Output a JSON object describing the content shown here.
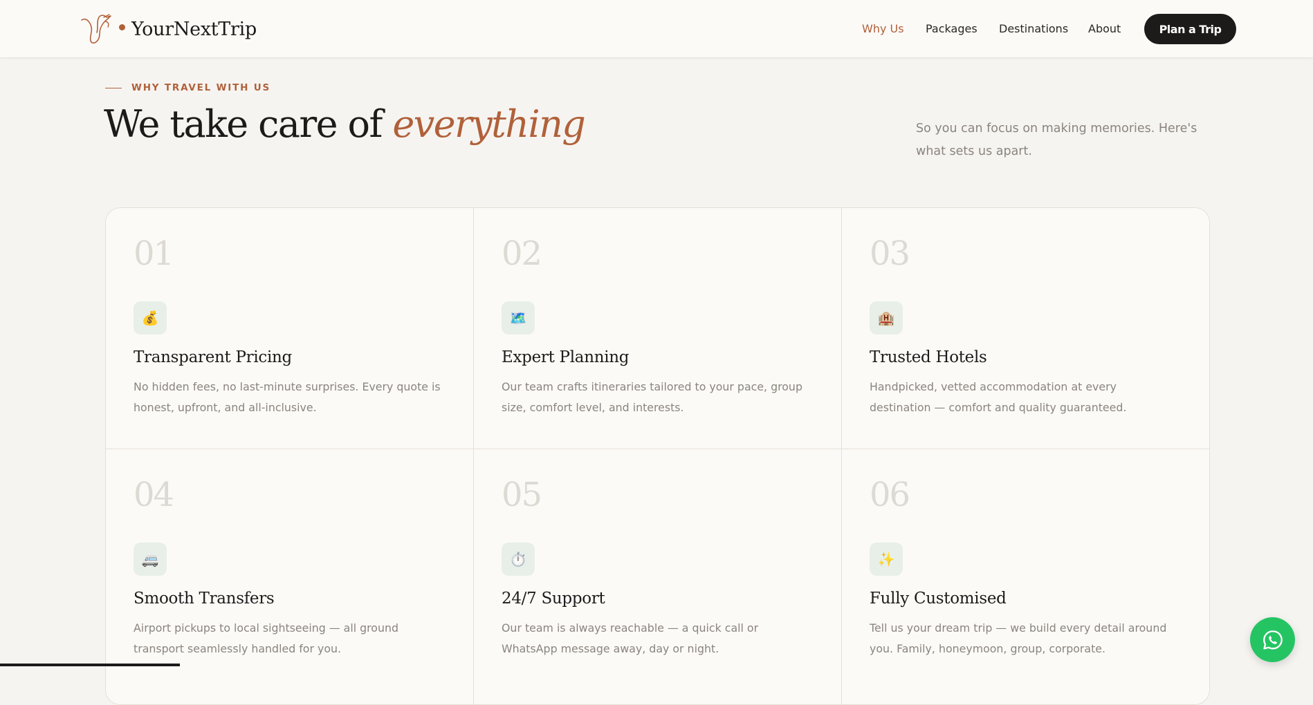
{
  "header": {
    "brand": "YourNextTrip",
    "nav": [
      {
        "label": "Why Us",
        "active": true
      },
      {
        "label": "Packages",
        "active": false
      },
      {
        "label": "Destinations",
        "active": false
      },
      {
        "label": "About",
        "active": false
      }
    ],
    "cta_label": "Plan a Trip"
  },
  "section": {
    "eyebrow": "WHY TRAVEL WITH US",
    "title_plain": "We take care of ",
    "title_accent": "everything",
    "subtitle": "So you can focus on making memories. Here's what sets us apart."
  },
  "features": [
    {
      "num": "01",
      "icon": "money-bag-icon",
      "glyph": "💰",
      "title": "Transparent Pricing",
      "desc": "No hidden fees, no last-minute surprises. Every quote is honest, upfront, and all-inclusive."
    },
    {
      "num": "02",
      "icon": "map-icon",
      "glyph": "🗺️",
      "title": "Expert Planning",
      "desc": "Our team crafts itineraries tailored to your pace, group size, comfort level, and interests."
    },
    {
      "num": "03",
      "icon": "hotel-icon",
      "glyph": "🏨",
      "title": "Trusted Hotels",
      "desc": "Handpicked, vetted accommodation at every destination — comfort and quality guaranteed."
    },
    {
      "num": "04",
      "icon": "van-icon",
      "glyph": "🚐",
      "title": "Smooth Transfers",
      "desc": "Airport pickups to local sightseeing — all ground transport seamlessly handled for you."
    },
    {
      "num": "05",
      "icon": "stopwatch-icon",
      "glyph": "⏱️",
      "title": "24/7 Support",
      "desc": "Our team is always reachable — a quick call or WhatsApp message away, day or night."
    },
    {
      "num": "06",
      "icon": "sparkles-icon",
      "glyph": "✨",
      "title": "Fully Customised",
      "desc": "Tell us your dream trip — we build every detail around you. Family, honeymoon, group, corporate."
    }
  ],
  "colors": {
    "accent": "#b0613a",
    "background": "#f6f4f1",
    "card": "#fcfaf7",
    "dark": "#1c1b1a",
    "whatsapp": "#25c463"
  }
}
